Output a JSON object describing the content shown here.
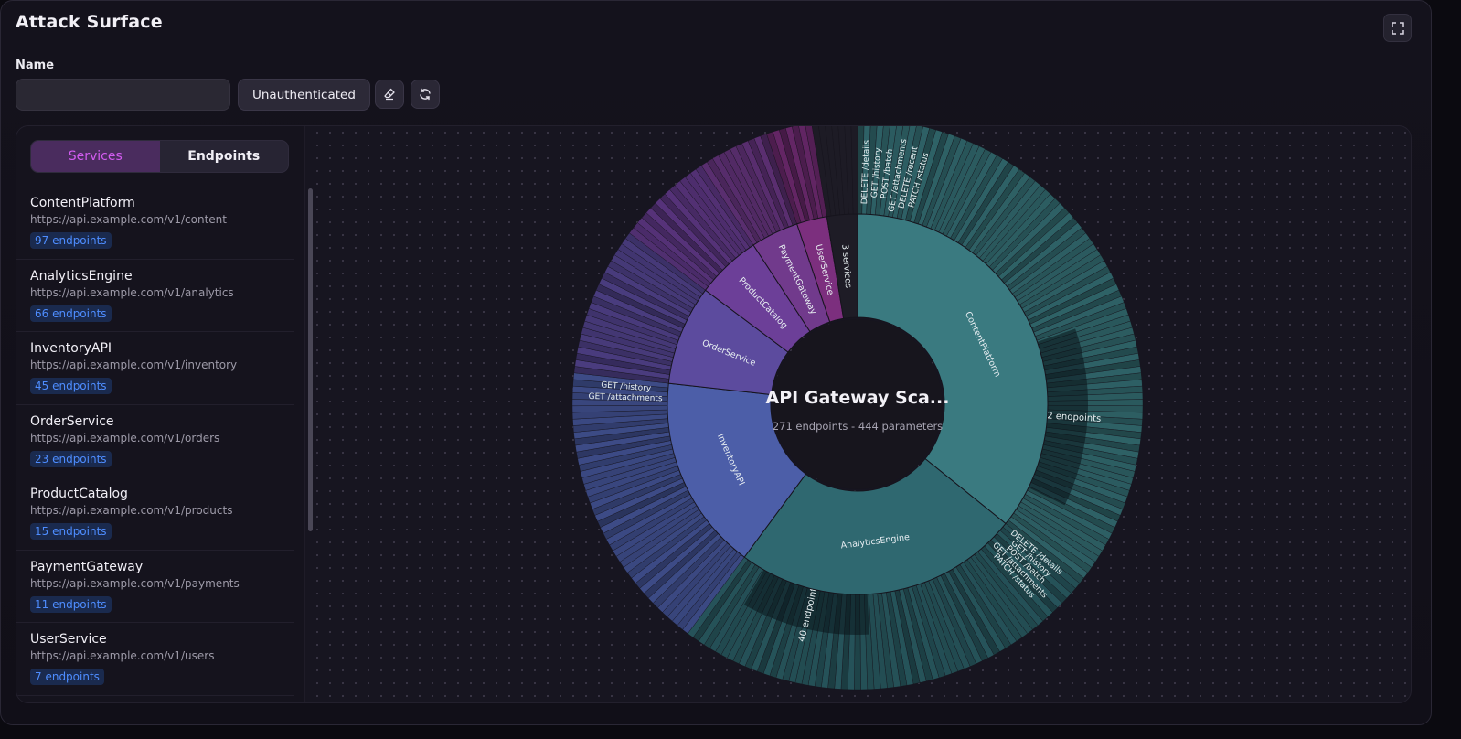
{
  "page": {
    "title": "Attack Surface"
  },
  "form": {
    "name_label": "Name",
    "name_value": "",
    "auth_label": "Unauthenticated"
  },
  "icons": {
    "expand": "expand-icon",
    "clear": "eraser-icon",
    "refresh": "refresh-icon"
  },
  "tabs": [
    {
      "label": "Services",
      "active": true
    },
    {
      "label": "Endpoints",
      "active": false
    }
  ],
  "services": [
    {
      "name": "ContentPlatform",
      "url": "https://api.example.com/v1/content",
      "badge": "97 endpoints",
      "endpoints": 97,
      "color": "#3a7a80"
    },
    {
      "name": "AnalyticsEngine",
      "url": "https://api.example.com/v1/analytics",
      "badge": "66 endpoints",
      "endpoints": 66,
      "color": "#2f6870"
    },
    {
      "name": "InventoryAPI",
      "url": "https://api.example.com/v1/inventory",
      "badge": "45 endpoints",
      "endpoints": 45,
      "color": "#4c5ea8"
    },
    {
      "name": "OrderService",
      "url": "https://api.example.com/v1/orders",
      "badge": "23 endpoints",
      "endpoints": 23,
      "color": "#5c4b9e"
    },
    {
      "name": "ProductCatalog",
      "url": "https://api.example.com/v1/products",
      "badge": "15 endpoints",
      "endpoints": 15,
      "color": "#6c3f98"
    },
    {
      "name": "PaymentGateway",
      "url": "https://api.example.com/v1/payments",
      "badge": "11 endpoints",
      "endpoints": 11,
      "color": "#713a8c"
    },
    {
      "name": "UserService",
      "url": "https://api.example.com/v1/users",
      "badge": "7 endpoints",
      "endpoints": 7,
      "color": "#7c2f7e"
    },
    {
      "name": "",
      "url": "",
      "badge": "",
      "endpoints": 7,
      "color": "#2a2733",
      "hidden": true
    }
  ],
  "sunburst": {
    "center_title": "API Gateway Sca...",
    "center_subtitle": "271 endpoints - 444 parameters",
    "group_label": "3 services",
    "collapsed_labels": [
      {
        "service": 0,
        "text": "52 endpoints"
      },
      {
        "service": 1,
        "text": "40 endpoints"
      }
    ],
    "endpoint_labels": [
      {
        "service": 0,
        "texts": [
          "DELETE /details",
          "GET /history",
          "POST /batch",
          "GET /attachments",
          "DELETE /recent",
          "PATCH /status"
        ]
      },
      {
        "service": 1,
        "texts": [
          "DELETE /details",
          "GET /history",
          "POST /batch",
          "GET /attachments",
          "PATCH /status"
        ]
      },
      {
        "service": 2,
        "texts": [
          "GET /attachments",
          "GET /history"
        ]
      }
    ]
  }
}
